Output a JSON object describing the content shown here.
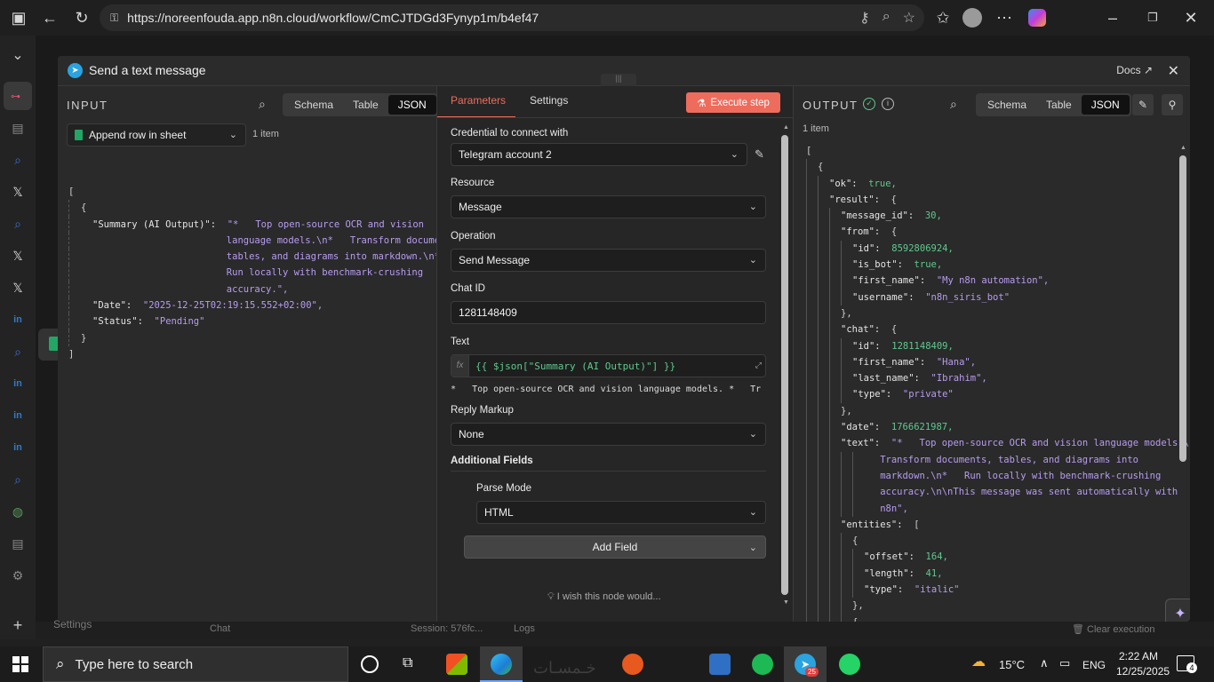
{
  "browser": {
    "url": "https://noreenfouda.app.n8n.cloud/workflow/CmCJTDGd3Fynyp1m/b4ef47"
  },
  "modal": {
    "title": "Send a text message",
    "docs_label": "Docs"
  },
  "input": {
    "label": "INPUT",
    "view_tabs": [
      "Schema",
      "Table",
      "JSON"
    ],
    "active_tab": "JSON",
    "source_node": "Append row in sheet",
    "item_count": "1 item",
    "json_lines": [
      {
        "t": "["
      },
      {
        "t": "{"
      },
      {
        "k": "\"Summary (AI Output)\":",
        "v": "\"*   Top open-source OCR and vision"
      },
      {
        "v": "language models.\\n*   Transform documents,"
      },
      {
        "v": "tables, and diagrams into markdown.\\n*"
      },
      {
        "v": "Run locally with benchmark-crushing"
      },
      {
        "v": "accuracy.\","
      },
      {
        "k": "\"Date\":",
        "v": "\"2025-12-25T02:19:15.552+02:00\","
      },
      {
        "k": "\"Status\":",
        "v": "\"Pending\""
      },
      {
        "t": "}"
      },
      {
        "t": "]"
      }
    ]
  },
  "params": {
    "tabs": [
      "Parameters",
      "Settings"
    ],
    "execute_label": "Execute step",
    "credential_label": "Credential to connect with",
    "credential_value": "Telegram account 2",
    "resource_label": "Resource",
    "resource_value": "Message",
    "operation_label": "Operation",
    "operation_value": "Send Message",
    "chat_id_label": "Chat ID",
    "chat_id_value": "1281148409",
    "text_label": "Text",
    "text_expression": "{{ $json[\"Summary (AI Output)\"] }}",
    "text_preview": "*   Top open-source OCR and vision language models. *   Tr",
    "reply_markup_label": "Reply Markup",
    "reply_markup_value": "None",
    "additional_fields_label": "Additional Fields",
    "parse_mode_label": "Parse Mode",
    "parse_mode_value": "HTML",
    "add_field_label": "Add Field",
    "wish_label": "I wish this node would..."
  },
  "output": {
    "label": "OUTPUT",
    "view_tabs": [
      "Schema",
      "Table",
      "JSON"
    ],
    "active_tab": "JSON",
    "item_count": "1 item",
    "json_lines": [
      {
        "i": 0,
        "t": "["
      },
      {
        "i": 1,
        "t": "{"
      },
      {
        "i": 2,
        "k": "\"ok\":",
        "b": "true,"
      },
      {
        "i": 2,
        "k": "\"result\":",
        "t": "{"
      },
      {
        "i": 3,
        "k": "\"message_id\":",
        "n": "30,"
      },
      {
        "i": 3,
        "k": "\"from\":",
        "t": "{"
      },
      {
        "i": 4,
        "k": "\"id\":",
        "n": "8592806924,"
      },
      {
        "i": 4,
        "k": "\"is_bot\":",
        "b": "true,"
      },
      {
        "i": 4,
        "k": "\"first_name\":",
        "v": "\"My n8n automation\","
      },
      {
        "i": 4,
        "k": "\"username\":",
        "v": "\"n8n_siris_bot\""
      },
      {
        "i": 3,
        "t": "},"
      },
      {
        "i": 3,
        "k": "\"chat\":",
        "t": "{"
      },
      {
        "i": 4,
        "k": "\"id\":",
        "n": "1281148409,"
      },
      {
        "i": 4,
        "k": "\"first_name\":",
        "v": "\"Hana\","
      },
      {
        "i": 4,
        "k": "\"last_name\":",
        "v": "\"Ibrahim\","
      },
      {
        "i": 4,
        "k": "\"type\":",
        "v": "\"private\""
      },
      {
        "i": 3,
        "t": "},"
      },
      {
        "i": 3,
        "k": "\"date\":",
        "n": "1766621987,"
      },
      {
        "i": 3,
        "k": "\"text\":",
        "v": "\"*   Top open-source OCR and vision language models.\\n*"
      },
      {
        "i": 5,
        "v": "Transform documents, tables, and diagrams into"
      },
      {
        "i": 5,
        "v": "markdown.\\n*   Run locally with benchmark-crushing"
      },
      {
        "i": 5,
        "v": "accuracy.\\n\\nThis message was sent automatically with"
      },
      {
        "i": 5,
        "v": "n8n\","
      },
      {
        "i": 3,
        "k": "\"entities\":",
        "t": "["
      },
      {
        "i": 4,
        "t": "{"
      },
      {
        "i": 5,
        "k": "\"offset\":",
        "n": "164,"
      },
      {
        "i": 5,
        "k": "\"length\":",
        "n": "41,"
      },
      {
        "i": 5,
        "k": "\"type\":",
        "v": "\"italic\""
      },
      {
        "i": 4,
        "t": "},"
      },
      {
        "i": 4,
        "t": "{"
      }
    ]
  },
  "bottom": {
    "settings": "Settings",
    "chat": "Chat",
    "session": "Session: 576fc...",
    "logs": "Logs",
    "clear": "Clear execution"
  },
  "taskbar": {
    "search_placeholder": "Type here to search",
    "weather": "15°C",
    "lang": "ENG",
    "time": "2:22 AM",
    "date": "12/25/2025",
    "notif_count": "4",
    "telegram_badge": "25"
  },
  "colors": {
    "accent": "#ee6c5c",
    "string": "#b79cf0",
    "number": "#5fc98d"
  }
}
